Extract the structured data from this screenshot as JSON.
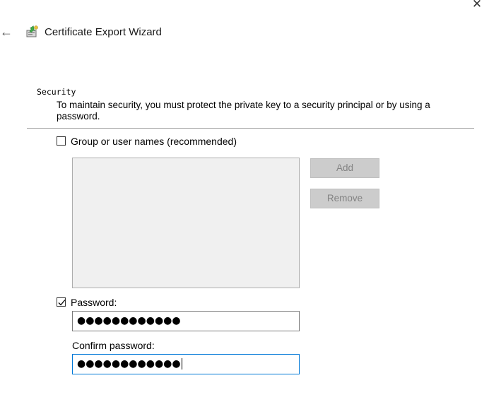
{
  "window": {
    "title": "Certificate Export Wizard",
    "close_glyph": "✕",
    "back_glyph": "←"
  },
  "header": {
    "heading": "Security",
    "description": "To maintain security, you must protect the private key to a security principal or by using a password."
  },
  "group_option": {
    "label": "Group or user names (recommended)",
    "checked": false,
    "items": []
  },
  "buttons": {
    "add": "Add",
    "remove": "Remove"
  },
  "password_option": {
    "label": "Password:",
    "checked": true,
    "value": "●●●●●●●●●●●●"
  },
  "confirm": {
    "label": "Confirm password:",
    "value": "●●●●●●●●●●●●"
  },
  "colors": {
    "accent": "#0078d7",
    "disabled_button": "#cccccc",
    "list_background": "#f0f0f0"
  },
  "icons": {
    "wizard": "certificate-icon",
    "back": "back-arrow-icon",
    "close": "close-icon",
    "check": "checkmark-icon"
  }
}
